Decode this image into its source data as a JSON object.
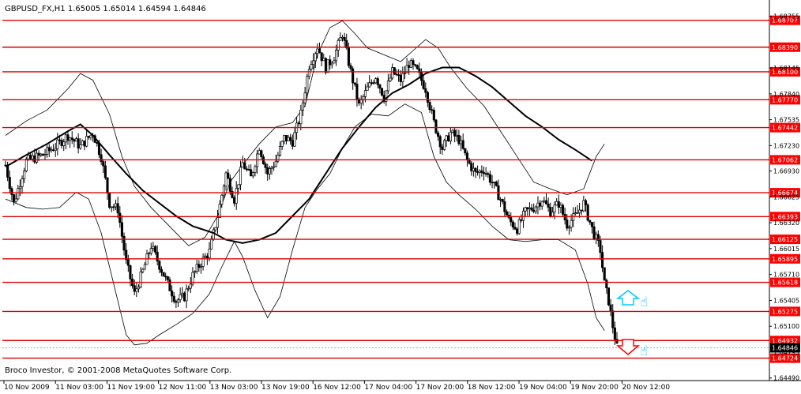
{
  "chart_data": {
    "type": "candlestick",
    "symbol_header": "GBPUSD_FX,H1  1.65005 1.65014 1.64594 1.64846",
    "copyright": "Broco Investor, © 2001-2008 MetaQuotes Software Corp.",
    "ylim": [
      1.6459,
      1.6876
    ],
    "y_ticks": [
      {
        "label": "1.68755",
        "value": 1.68755
      },
      {
        "label": "1.68145",
        "value": 1.68145
      },
      {
        "label": "1.67840",
        "value": 1.6784
      },
      {
        "label": "1.67535",
        "value": 1.67535
      },
      {
        "label": "1.67230",
        "value": 1.6723
      },
      {
        "label": "1.66930",
        "value": 1.6693
      },
      {
        "label": "1.66625",
        "value": 1.66625
      },
      {
        "label": "1.66320",
        "value": 1.6632
      },
      {
        "label": "1.66015",
        "value": 1.66015
      },
      {
        "label": "1.65710",
        "value": 1.6571
      },
      {
        "label": "1.65405",
        "value": 1.65405
      },
      {
        "label": "1.65100",
        "value": 1.651
      },
      {
        "label": "1.64795",
        "value": 1.64795
      },
      {
        "label": "1.64490",
        "value": 1.6449
      }
    ],
    "x_ticks": [
      "10 Nov 2009",
      "11 Nov 03:00",
      "11 Nov 19:00",
      "12 Nov 11:00",
      "13 Nov 03:00",
      "13 Nov 19:00",
      "16 Nov 12:00",
      "17 Nov 04:00",
      "17 Nov 20:00",
      "18 Nov 12:00",
      "19 Nov 04:00",
      "19 Nov 20:00",
      "20 Nov 12:00"
    ],
    "hlines": [
      {
        "label": "1.68707",
        "value": 1.68707
      },
      {
        "label": "1.68390",
        "value": 1.6839
      },
      {
        "label": "1.68100",
        "value": 1.681
      },
      {
        "label": "1.67770",
        "value": 1.6777
      },
      {
        "label": "1.67442",
        "value": 1.67442
      },
      {
        "label": "1.67062",
        "value": 1.67062
      },
      {
        "label": "1.66674",
        "value": 1.66674
      },
      {
        "label": "1.66393",
        "value": 1.66393
      },
      {
        "label": "1.66125",
        "value": 1.66125
      },
      {
        "label": "1.65895",
        "value": 1.65895
      },
      {
        "label": "1.65618",
        "value": 1.65618
      },
      {
        "label": "1.65275",
        "value": 1.65275
      },
      {
        "label": "1.64932",
        "value": 1.64932
      },
      {
        "label": "1.64724",
        "value": 1.64724
      }
    ],
    "current_price": {
      "label": "1.64846",
      "value": 1.64846
    },
    "price_path": [
      [
        0,
        1.67
      ],
      [
        4,
        1.6655
      ],
      [
        10,
        1.6705
      ],
      [
        18,
        1.6712
      ],
      [
        24,
        1.6722
      ],
      [
        30,
        1.6735
      ],
      [
        36,
        1.6722
      ],
      [
        42,
        1.6738
      ],
      [
        46,
        1.671
      ],
      [
        50,
        1.6655
      ],
      [
        54,
        1.6648
      ],
      [
        58,
        1.6585
      ],
      [
        62,
        1.6548
      ],
      [
        66,
        1.6575
      ],
      [
        70,
        1.6605
      ],
      [
        74,
        1.6582
      ],
      [
        78,
        1.656
      ],
      [
        82,
        1.654
      ],
      [
        86,
        1.6545
      ],
      [
        90,
        1.657
      ],
      [
        94,
        1.6585
      ],
      [
        98,
        1.6598
      ],
      [
        102,
        1.664
      ],
      [
        106,
        1.669
      ],
      [
        110,
        1.666
      ],
      [
        114,
        1.6702
      ],
      [
        118,
        1.6685
      ],
      [
        122,
        1.6722
      ],
      [
        126,
        1.669
      ],
      [
        130,
        1.6705
      ],
      [
        134,
        1.6732
      ],
      [
        138,
        1.6728
      ],
      [
        142,
        1.676
      ],
      [
        146,
        1.6818
      ],
      [
        150,
        1.684
      ],
      [
        154,
        1.6815
      ],
      [
        158,
        1.6828
      ],
      [
        162,
        1.6855
      ],
      [
        166,
        1.681
      ],
      [
        170,
        1.677
      ],
      [
        174,
        1.679
      ],
      [
        178,
        1.6805
      ],
      [
        182,
        1.678
      ],
      [
        186,
        1.681
      ],
      [
        190,
        1.68
      ],
      [
        194,
        1.682
      ],
      [
        198,
        1.681
      ],
      [
        202,
        1.679
      ],
      [
        206,
        1.675
      ],
      [
        210,
        1.672
      ],
      [
        214,
        1.6738
      ],
      [
        218,
        1.673
      ],
      [
        222,
        1.6705
      ],
      [
        226,
        1.669
      ],
      [
        230,
        1.6695
      ],
      [
        234,
        1.668
      ],
      [
        238,
        1.666
      ],
      [
        242,
        1.6635
      ],
      [
        246,
        1.6625
      ],
      [
        250,
        1.6645
      ],
      [
        254,
        1.665
      ],
      [
        258,
        1.666
      ],
      [
        262,
        1.6645
      ],
      [
        266,
        1.6655
      ],
      [
        270,
        1.663
      ],
      [
        274,
        1.664
      ],
      [
        278,
        1.6655
      ],
      [
        282,
        1.6625
      ],
      [
        286,
        1.66
      ],
      [
        288,
        1.656
      ],
      [
        290,
        1.654
      ],
      [
        292,
        1.651
      ],
      [
        294,
        1.6485
      ]
    ],
    "moving_average": [
      [
        0,
        1.6698
      ],
      [
        10,
        1.6712
      ],
      [
        20,
        1.6725
      ],
      [
        30,
        1.674
      ],
      [
        36,
        1.6748
      ],
      [
        42,
        1.6735
      ],
      [
        50,
        1.6712
      ],
      [
        58,
        1.669
      ],
      [
        66,
        1.667
      ],
      [
        74,
        1.6655
      ],
      [
        82,
        1.664
      ],
      [
        90,
        1.6628
      ],
      [
        100,
        1.662
      ],
      [
        106,
        1.6612
      ],
      [
        114,
        1.6608
      ],
      [
        122,
        1.6612
      ],
      [
        130,
        1.662
      ],
      [
        138,
        1.664
      ],
      [
        146,
        1.666
      ],
      [
        154,
        1.669
      ],
      [
        162,
        1.672
      ],
      [
        170,
        1.6745
      ],
      [
        178,
        1.6768
      ],
      [
        186,
        1.6785
      ],
      [
        194,
        1.6795
      ],
      [
        202,
        1.6808
      ],
      [
        210,
        1.6815
      ],
      [
        218,
        1.6815
      ],
      [
        226,
        1.6805
      ],
      [
        234,
        1.6792
      ],
      [
        242,
        1.6775
      ],
      [
        250,
        1.6758
      ],
      [
        258,
        1.6745
      ],
      [
        266,
        1.673
      ],
      [
        274,
        1.6718
      ],
      [
        282,
        1.6705
      ]
    ],
    "bollinger_upper": [
      [
        0,
        1.6735
      ],
      [
        10,
        1.6752
      ],
      [
        20,
        1.6765
      ],
      [
        30,
        1.679
      ],
      [
        36,
        1.6808
      ],
      [
        42,
        1.68
      ],
      [
        46,
        1.678
      ],
      [
        50,
        1.676
      ],
      [
        56,
        1.671
      ],
      [
        62,
        1.6675
      ],
      [
        70,
        1.665
      ],
      [
        80,
        1.6625
      ],
      [
        88,
        1.6605
      ],
      [
        96,
        1.6615
      ],
      [
        102,
        1.664
      ],
      [
        108,
        1.668
      ],
      [
        114,
        1.67
      ],
      [
        122,
        1.6725
      ],
      [
        130,
        1.6745
      ],
      [
        138,
        1.675
      ],
      [
        144,
        1.677
      ],
      [
        150,
        1.683
      ],
      [
        156,
        1.6862
      ],
      [
        162,
        1.687
      ],
      [
        168,
        1.6855
      ],
      [
        174,
        1.6838
      ],
      [
        182,
        1.683
      ],
      [
        190,
        1.6822
      ],
      [
        196,
        1.6835
      ],
      [
        202,
        1.6848
      ],
      [
        208,
        1.6838
      ],
      [
        214,
        1.6815
      ],
      [
        222,
        1.679
      ],
      [
        230,
        1.677
      ],
      [
        238,
        1.674
      ],
      [
        246,
        1.671
      ],
      [
        254,
        1.668
      ],
      [
        262,
        1.6672
      ],
      [
        270,
        1.6665
      ],
      [
        278,
        1.6672
      ],
      [
        284,
        1.671
      ],
      [
        288,
        1.6725
      ]
    ],
    "bollinger_lower": [
      [
        0,
        1.666
      ],
      [
        10,
        1.665
      ],
      [
        18,
        1.6648
      ],
      [
        26,
        1.665
      ],
      [
        34,
        1.6668
      ],
      [
        40,
        1.666
      ],
      [
        46,
        1.662
      ],
      [
        52,
        1.656
      ],
      [
        58,
        1.65
      ],
      [
        62,
        1.6488
      ],
      [
        68,
        1.649
      ],
      [
        74,
        1.65
      ],
      [
        82,
        1.6512
      ],
      [
        90,
        1.6525
      ],
      [
        98,
        1.6548
      ],
      [
        104,
        1.658
      ],
      [
        110,
        1.661
      ],
      [
        114,
        1.6592
      ],
      [
        120,
        1.6552
      ],
      [
        126,
        1.652
      ],
      [
        132,
        1.6545
      ],
      [
        138,
        1.66
      ],
      [
        144,
        1.665
      ],
      [
        150,
        1.6672
      ],
      [
        156,
        1.669
      ],
      [
        162,
        1.672
      ],
      [
        168,
        1.6745
      ],
      [
        176,
        1.676
      ],
      [
        184,
        1.6758
      ],
      [
        192,
        1.6772
      ],
      [
        200,
        1.6762
      ],
      [
        206,
        1.671
      ],
      [
        212,
        1.668
      ],
      [
        218,
        1.6665
      ],
      [
        226,
        1.6648
      ],
      [
        234,
        1.6628
      ],
      [
        242,
        1.6612
      ],
      [
        250,
        1.661
      ],
      [
        258,
        1.6612
      ],
      [
        266,
        1.6612
      ],
      [
        274,
        1.66
      ],
      [
        280,
        1.656
      ],
      [
        284,
        1.652
      ],
      [
        288,
        1.6505
      ]
    ]
  }
}
